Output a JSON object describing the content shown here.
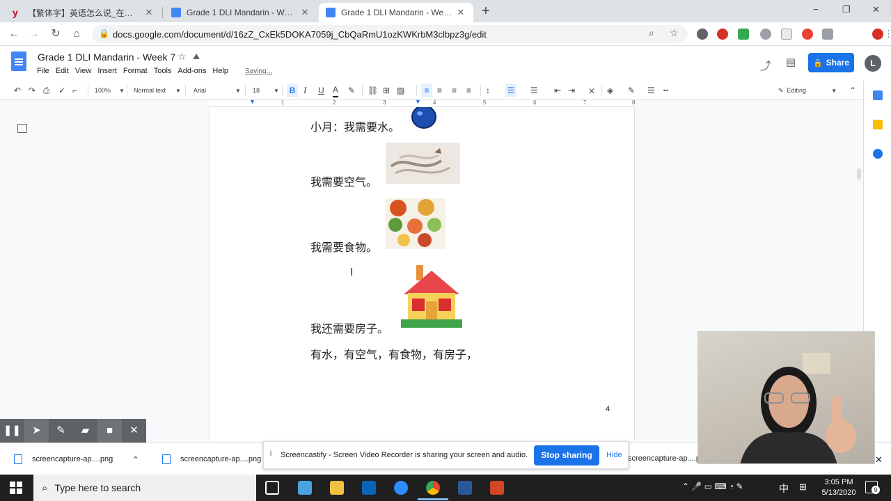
{
  "browser": {
    "tabs": [
      {
        "label": "【繁体字】英语怎么说_在线翻译_汉",
        "active": false
      },
      {
        "label": "Grade 1 DLI Mandarin - Week 6 -",
        "active": false
      },
      {
        "label": "Grade 1 DLI Mandarin - Week 7 -",
        "active": true
      }
    ],
    "new_tab": "+",
    "window_controls": [
      "−",
      "❐",
      "✕"
    ],
    "url": "docs.google.com/document/d/16zZ_CxEk5DOKA7059j_CbQaRmU1ozKWKrbM3clbpz3g/edit",
    "avatar_letter": "L"
  },
  "docs": {
    "title": "Grade 1 DLI Mandarin - Week 7",
    "menu": [
      "File",
      "Edit",
      "View",
      "Insert",
      "Format",
      "Tools",
      "Add-ons",
      "Help"
    ],
    "saving": "Saving...",
    "share_label": "Share",
    "avatar_letter": "L",
    "toolbar": {
      "zoom": "100%",
      "style": "Normal text",
      "font": "Arial",
      "size": "18",
      "mode": "Editing",
      "bold": "B",
      "italic": "I",
      "underline": "U",
      "text_color": "A"
    },
    "ruler_numbers": [
      "1",
      "1",
      "2",
      "3",
      "4",
      "5",
      "6",
      "7",
      "8"
    ],
    "page_number": "4"
  },
  "document_lines": [
    "小月：我需要水。",
    "我需要空气。",
    "我需要食物。",
    "我还需要房子。",
    "有水，有空气，有食物，有房子，"
  ],
  "screencastify": {
    "controls": [
      "pause-icon",
      "cursor-icon",
      "pen-icon",
      "eraser-icon",
      "camera-icon",
      "close-icon"
    ],
    "banner_text": "Screencastify - Screen Video Recorder is sharing your screen and audio.",
    "stop_label": "Stop sharing",
    "hide_label": "Hide"
  },
  "downloads": [
    "screencapture-ap....png",
    "screencapture-ap....png",
    "screencapture-ap....p"
  ],
  "taskbar": {
    "search_placeholder": "Type here to search",
    "time": "3:05 PM",
    "date": "5/13/2020",
    "ime": "中",
    "notification_count": "9"
  },
  "colors": {
    "docs_blue": "#4285f4",
    "share_blue": "#1a73e8",
    "taskbar": "#1f1f1f"
  }
}
